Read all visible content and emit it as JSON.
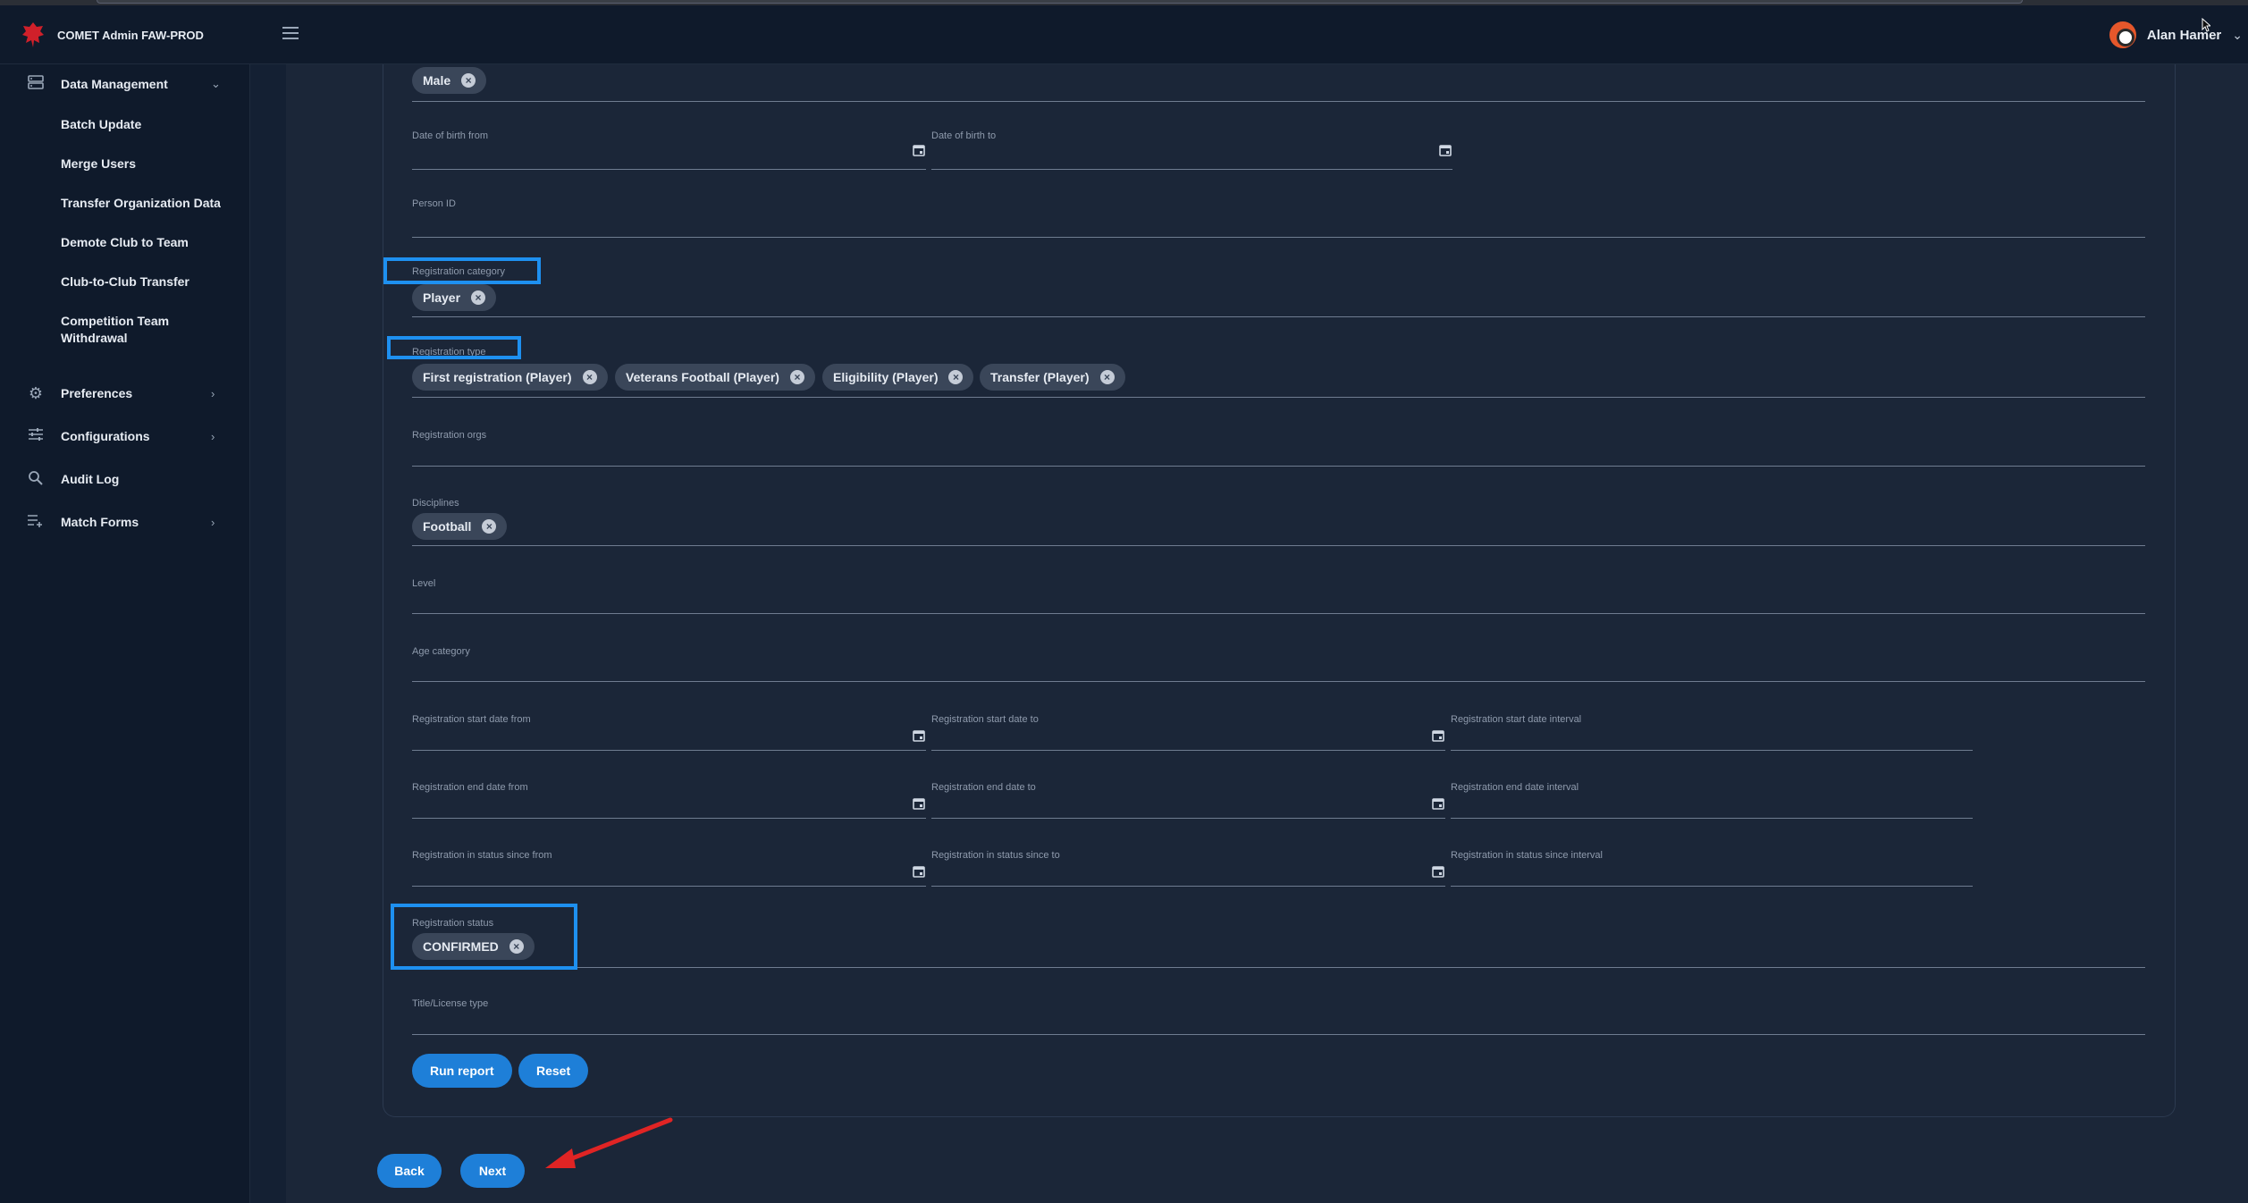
{
  "app": {
    "title": "COMET Admin FAW-PROD"
  },
  "user": {
    "name": "Alan Hamer"
  },
  "sidebar": {
    "data_management": {
      "label": "Data Management",
      "items": [
        {
          "label": "Batch Update"
        },
        {
          "label": "Merge Users"
        },
        {
          "label": "Transfer Organization Data"
        },
        {
          "label": "Demote Club to Team"
        },
        {
          "label": "Club-to-Club Transfer"
        },
        {
          "label": "Competition Team Withdrawal"
        }
      ]
    },
    "preferences": {
      "label": "Preferences"
    },
    "configurations": {
      "label": "Configurations"
    },
    "audit_log": {
      "label": "Audit Log"
    },
    "match_forms": {
      "label": "Match Forms"
    }
  },
  "form": {
    "gender_chip": "Male",
    "dob_from": {
      "label": "Date of birth from"
    },
    "dob_to": {
      "label": "Date of birth to"
    },
    "person_id": {
      "label": "Person ID"
    },
    "registration_category": {
      "label": "Registration category",
      "chips": [
        "Player"
      ]
    },
    "registration_type": {
      "label": "Registration type",
      "chips": [
        "First registration (Player)",
        "Veterans Football (Player)",
        "Eligibility (Player)",
        "Transfer (Player)"
      ]
    },
    "registration_orgs": {
      "label": "Registration orgs"
    },
    "disciplines": {
      "label": "Disciplines",
      "chips": [
        "Football"
      ]
    },
    "level": {
      "label": "Level"
    },
    "age_category": {
      "label": "Age category"
    },
    "reg_start": {
      "from": "Registration start date from",
      "to": "Registration start date to",
      "interval": "Registration start date interval"
    },
    "reg_end": {
      "from": "Registration end date from",
      "to": "Registration end date to",
      "interval": "Registration end date interval"
    },
    "reg_status_since": {
      "from": "Registration in status since from",
      "to": "Registration in status since to",
      "interval": "Registration in status since interval"
    },
    "registration_status": {
      "label": "Registration status",
      "chips": [
        "CONFIRMED"
      ]
    },
    "title_license": {
      "label": "Title/License type"
    },
    "run_report": "Run report",
    "reset": "Reset"
  },
  "footer": {
    "back": "Back",
    "next": "Next"
  },
  "colors": {
    "accent": "#1e7fd8",
    "highlight": "#1e90f0",
    "arrow": "#e02424"
  }
}
